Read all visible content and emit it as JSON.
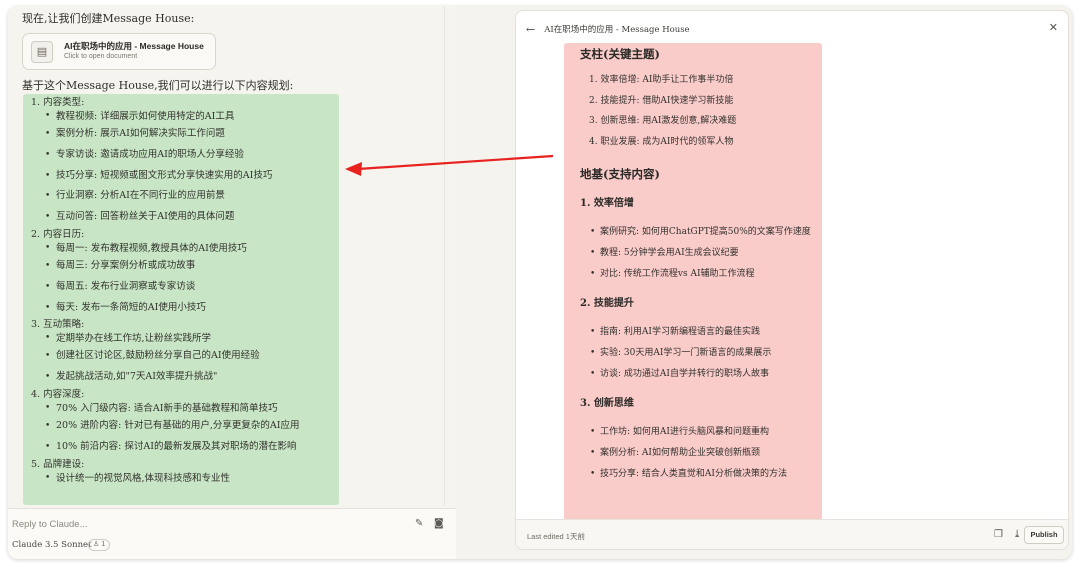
{
  "chat": {
    "intro": "现在,让我们创建Message House:",
    "doc_card": {
      "title": "AI在职场中的应用 - Message House",
      "subtitle": "Click to open document",
      "icon": "document-icon"
    },
    "lead": "基于这个Message House,我们可以进行以下内容规划:",
    "sections": [
      {
        "title": "1. 内容类型:",
        "items": [
          "教程视频: 详细展示如何使用特定的AI工具",
          "案例分析: 展示AI如何解决实际工作问题",
          "专家访谈: 邀请成功应用AI的职场人分享经验",
          "技巧分享: 短视频或图文形式分享快速实用的AI技巧",
          "行业洞察: 分析AI在不同行业的应用前景",
          "互动问答: 回答粉丝关于AI使用的具体问题"
        ]
      },
      {
        "title": "2. 内容日历:",
        "items": [
          "每周一: 发布教程视频,教授具体的AI使用技巧",
          "每周三: 分享案例分析或成功故事",
          "每周五: 发布行业洞察或专家访谈",
          "每天: 发布一条简短的AI使用小技巧"
        ]
      },
      {
        "title": "3. 互动策略:",
        "items": [
          "定期举办在线工作坊,让粉丝实践所学",
          "创建社区讨论区,鼓励粉丝分享自己的AI使用经验",
          "发起挑战活动,如\"7天AI效率提升挑战\""
        ]
      },
      {
        "title": "4. 内容深度:",
        "items": [
          "70% 入门级内容: 适合AI新手的基础教程和简单技巧",
          "20% 进阶内容: 针对已有基础的用户,分享更复杂的AI应用",
          "10% 前沿内容: 探讨AI的最新发展及其对职场的潜在影响"
        ]
      },
      {
        "title": "5. 品牌建设:",
        "items": [
          "设计统一的视觉风格,体现科技感和专业性"
        ]
      }
    ],
    "reply_placeholder": "Reply to Claude...",
    "model_name": "Claude 3.5 Sonnet",
    "model_badge": "1"
  },
  "artifact": {
    "title": "AI在职场中的应用 - Message House",
    "pillars_heading": "支柱(关键主题)",
    "pillars": [
      "1. 效率倍增: AI助手让工作事半功倍",
      "2. 技能提升: 借助AI快速学习新技能",
      "3. 创新思维: 用AI激发创意,解决难题",
      "4. 职业发展: 成为AI时代的领军人物"
    ],
    "foundation_heading": "地基(支持内容)",
    "groups": [
      {
        "title": "1. 效率倍增",
        "items": [
          "案例研究: 如何用ChatGPT提高50%的文案写作速度",
          "教程: 5分钟学会用AI生成会议纪要",
          "对比: 传统工作流程vs AI辅助工作流程"
        ]
      },
      {
        "title": "2. 技能提升",
        "items": [
          "指南: 利用AI学习新编程语言的最佳实践",
          "实验: 30天用AI学习一门新语言的成果展示",
          "访谈: 成功通过AI自学并转行的职场人故事"
        ]
      },
      {
        "title": "3. 创新思维",
        "items": [
          "工作坊: 如何用AI进行头脑风暴和问题重构",
          "案例分析: AI如何帮助企业突破创新瓶颈",
          "技巧分享: 结合人类直觉和AI分析做决策的方法"
        ]
      }
    ],
    "last_edited": "Last edited 1天前",
    "publish_label": "Publish"
  },
  "colors": {
    "green_highlight": "#c8e6c5",
    "pink_highlight": "#f9cbc9",
    "arrow": "#e8231f"
  }
}
